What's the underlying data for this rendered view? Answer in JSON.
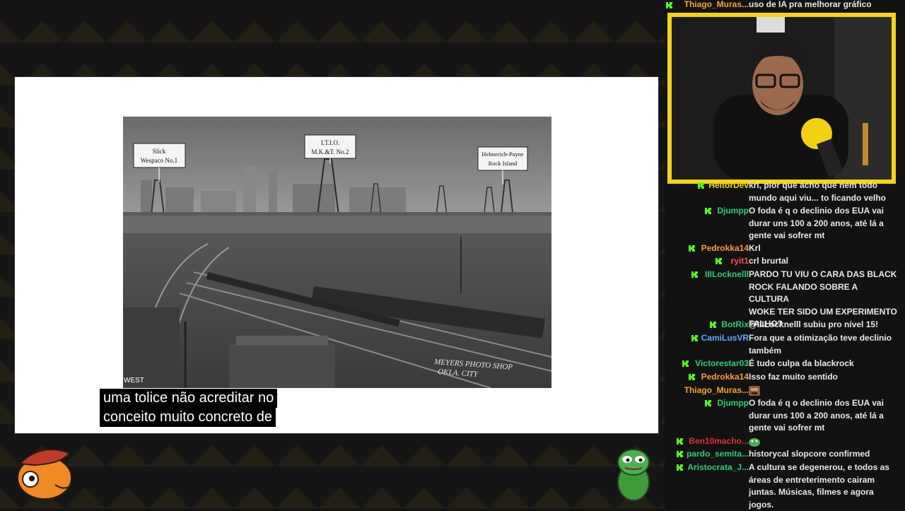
{
  "caption": {
    "line1": "uma tolice não acreditar no",
    "line2": "conceito muito concreto de"
  },
  "photo": {
    "signs": [
      "Slick",
      "Wespaco No.1",
      "I.T.I.O.",
      "M.K.&T. No.2",
      "Helmerich-Payne",
      "Rock Island"
    ],
    "watermark1": "MEYERS PHOTO SHOP",
    "watermark2": "OKLA. CITY",
    "corner_label": "WEST"
  },
  "chat": {
    "partial_top": {
      "user": "Thiago_Muras...",
      "message": "uso de IA pra melhorar gráfico"
    },
    "messages": [
      {
        "user": "HeitorDev",
        "color": "#f5d50f",
        "line1": "krl, pior que acho que nem todo",
        "line2": "mundo aqui viu... to ficando velho"
      },
      {
        "user": "Djumpp",
        "color": "#2ecc71",
        "line1": "O foda é q o declinio dos EUA vai",
        "line2": "durar uns 100 a 200 anos, até lá a",
        "line3": "gente vai sofrer mt"
      },
      {
        "user": "Pedrokka14",
        "color": "#ff9933",
        "line1": "Krl"
      },
      {
        "user": "ryit1",
        "color": "#ff4d4d",
        "line1": "crl brurtal"
      },
      {
        "user": "IIILocknelll",
        "color": "#2ecc71",
        "line1": "PARDO TU VIU O CARA DAS BLACK",
        "line2": "ROCK FALANDO SOBRE A CULTURA",
        "line3": "WOKE TER SIDO UM EXPERIMENTO",
        "line4": "FALHO?"
      },
      {
        "user": "BotRix",
        "color": "#2ecc71",
        "line1": "@IIILocknelll subiu pro nível 15!"
      },
      {
        "user": "CamiLusVR",
        "color": "#5aa9ff",
        "line1": "Fora que a otimização teve declinio",
        "line2": "também"
      },
      {
        "user": "Victorestar03",
        "color": "#2ecc71",
        "line1": "É tudo culpa da blackrock"
      },
      {
        "user": "Pedrokka14",
        "color": "#ff9933",
        "line1": "Isso faz muito sentido"
      },
      {
        "user": "Thiago_Muras...",
        "color": "#f5a623",
        "line1": ""
      },
      {
        "user": "Djumpp",
        "color": "#2ecc71",
        "line1": "O foda é q o declinio dos EUA vai",
        "line2": "durar uns 100 a 200 anos, até lá a",
        "line3": "gente vai sofrer mt"
      },
      {
        "user": "Ben10macho...",
        "color": "#e03030",
        "line1": ""
      },
      {
        "user": "pardo_semita...",
        "color": "#2ecc71",
        "line1": "historycal slopcore confirmed"
      },
      {
        "user": "Aristocrata_J...",
        "color": "#2ecc71",
        "line1": "A cultura se degenerou, e todos as",
        "line2": "áreas de entreterimento cairam",
        "line3": "juntas. Músicas, filmes e agora jogos."
      }
    ]
  },
  "colors": {
    "accent": "#f5d50f",
    "badge": "#53fc18"
  },
  "icons": [
    "kick-badge-icon",
    "pepe-emote-icon",
    "face-emote-icon",
    "mascot-sticker-icon",
    "pepe-sticker-icon"
  ]
}
